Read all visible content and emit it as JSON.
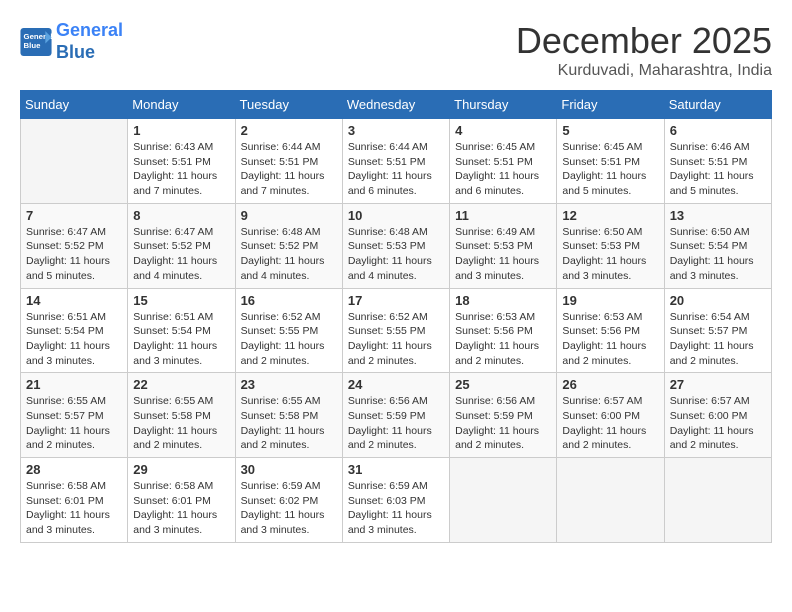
{
  "header": {
    "logo_line1": "General",
    "logo_line2": "Blue",
    "month_title": "December 2025",
    "location": "Kurduvadi, Maharashtra, India"
  },
  "weekdays": [
    "Sunday",
    "Monday",
    "Tuesday",
    "Wednesday",
    "Thursday",
    "Friday",
    "Saturday"
  ],
  "weeks": [
    [
      {
        "day": "",
        "info": ""
      },
      {
        "day": "1",
        "info": "Sunrise: 6:43 AM\nSunset: 5:51 PM\nDaylight: 11 hours\nand 7 minutes."
      },
      {
        "day": "2",
        "info": "Sunrise: 6:44 AM\nSunset: 5:51 PM\nDaylight: 11 hours\nand 7 minutes."
      },
      {
        "day": "3",
        "info": "Sunrise: 6:44 AM\nSunset: 5:51 PM\nDaylight: 11 hours\nand 6 minutes."
      },
      {
        "day": "4",
        "info": "Sunrise: 6:45 AM\nSunset: 5:51 PM\nDaylight: 11 hours\nand 6 minutes."
      },
      {
        "day": "5",
        "info": "Sunrise: 6:45 AM\nSunset: 5:51 PM\nDaylight: 11 hours\nand 5 minutes."
      },
      {
        "day": "6",
        "info": "Sunrise: 6:46 AM\nSunset: 5:51 PM\nDaylight: 11 hours\nand 5 minutes."
      }
    ],
    [
      {
        "day": "7",
        "info": "Sunrise: 6:47 AM\nSunset: 5:52 PM\nDaylight: 11 hours\nand 5 minutes."
      },
      {
        "day": "8",
        "info": "Sunrise: 6:47 AM\nSunset: 5:52 PM\nDaylight: 11 hours\nand 4 minutes."
      },
      {
        "day": "9",
        "info": "Sunrise: 6:48 AM\nSunset: 5:52 PM\nDaylight: 11 hours\nand 4 minutes."
      },
      {
        "day": "10",
        "info": "Sunrise: 6:48 AM\nSunset: 5:53 PM\nDaylight: 11 hours\nand 4 minutes."
      },
      {
        "day": "11",
        "info": "Sunrise: 6:49 AM\nSunset: 5:53 PM\nDaylight: 11 hours\nand 3 minutes."
      },
      {
        "day": "12",
        "info": "Sunrise: 6:50 AM\nSunset: 5:53 PM\nDaylight: 11 hours\nand 3 minutes."
      },
      {
        "day": "13",
        "info": "Sunrise: 6:50 AM\nSunset: 5:54 PM\nDaylight: 11 hours\nand 3 minutes."
      }
    ],
    [
      {
        "day": "14",
        "info": "Sunrise: 6:51 AM\nSunset: 5:54 PM\nDaylight: 11 hours\nand 3 minutes."
      },
      {
        "day": "15",
        "info": "Sunrise: 6:51 AM\nSunset: 5:54 PM\nDaylight: 11 hours\nand 3 minutes."
      },
      {
        "day": "16",
        "info": "Sunrise: 6:52 AM\nSunset: 5:55 PM\nDaylight: 11 hours\nand 2 minutes."
      },
      {
        "day": "17",
        "info": "Sunrise: 6:52 AM\nSunset: 5:55 PM\nDaylight: 11 hours\nand 2 minutes."
      },
      {
        "day": "18",
        "info": "Sunrise: 6:53 AM\nSunset: 5:56 PM\nDaylight: 11 hours\nand 2 minutes."
      },
      {
        "day": "19",
        "info": "Sunrise: 6:53 AM\nSunset: 5:56 PM\nDaylight: 11 hours\nand 2 minutes."
      },
      {
        "day": "20",
        "info": "Sunrise: 6:54 AM\nSunset: 5:57 PM\nDaylight: 11 hours\nand 2 minutes."
      }
    ],
    [
      {
        "day": "21",
        "info": "Sunrise: 6:55 AM\nSunset: 5:57 PM\nDaylight: 11 hours\nand 2 minutes."
      },
      {
        "day": "22",
        "info": "Sunrise: 6:55 AM\nSunset: 5:58 PM\nDaylight: 11 hours\nand 2 minutes."
      },
      {
        "day": "23",
        "info": "Sunrise: 6:55 AM\nSunset: 5:58 PM\nDaylight: 11 hours\nand 2 minutes."
      },
      {
        "day": "24",
        "info": "Sunrise: 6:56 AM\nSunset: 5:59 PM\nDaylight: 11 hours\nand 2 minutes."
      },
      {
        "day": "25",
        "info": "Sunrise: 6:56 AM\nSunset: 5:59 PM\nDaylight: 11 hours\nand 2 minutes."
      },
      {
        "day": "26",
        "info": "Sunrise: 6:57 AM\nSunset: 6:00 PM\nDaylight: 11 hours\nand 2 minutes."
      },
      {
        "day": "27",
        "info": "Sunrise: 6:57 AM\nSunset: 6:00 PM\nDaylight: 11 hours\nand 2 minutes."
      }
    ],
    [
      {
        "day": "28",
        "info": "Sunrise: 6:58 AM\nSunset: 6:01 PM\nDaylight: 11 hours\nand 3 minutes."
      },
      {
        "day": "29",
        "info": "Sunrise: 6:58 AM\nSunset: 6:01 PM\nDaylight: 11 hours\nand 3 minutes."
      },
      {
        "day": "30",
        "info": "Sunrise: 6:59 AM\nSunset: 6:02 PM\nDaylight: 11 hours\nand 3 minutes."
      },
      {
        "day": "31",
        "info": "Sunrise: 6:59 AM\nSunset: 6:03 PM\nDaylight: 11 hours\nand 3 minutes."
      },
      {
        "day": "",
        "info": ""
      },
      {
        "day": "",
        "info": ""
      },
      {
        "day": "",
        "info": ""
      }
    ]
  ]
}
